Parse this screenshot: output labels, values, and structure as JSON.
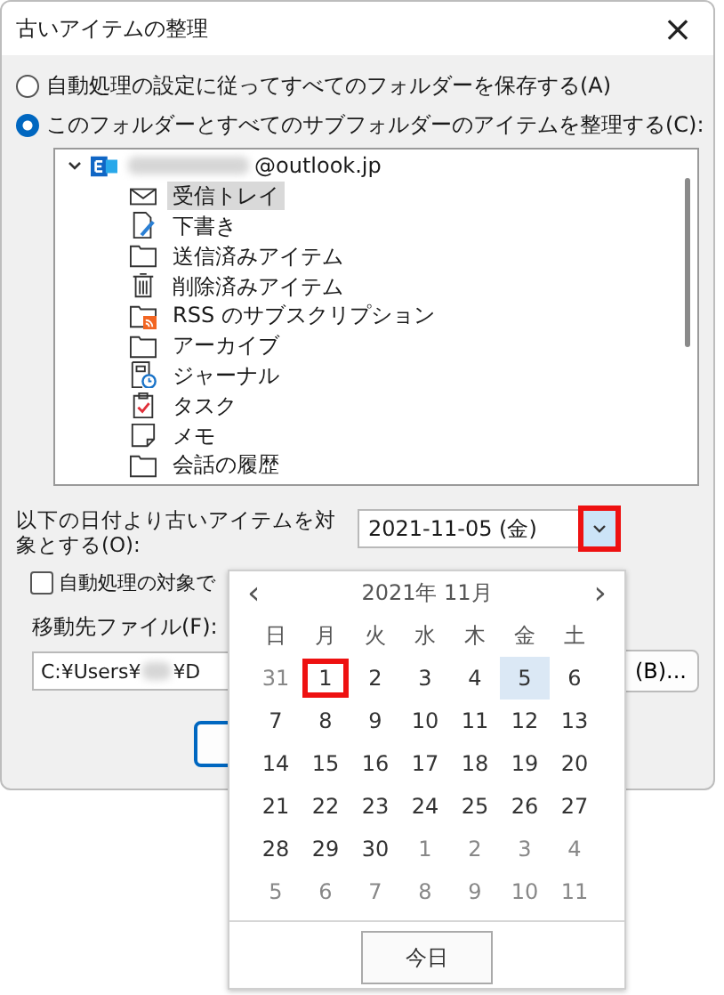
{
  "window": {
    "title": "古いアイテムの整理",
    "close": "×"
  },
  "options": [
    {
      "label": "自動処理の設定に従ってすべてのフォルダーを保存する(A)",
      "selected": false
    },
    {
      "label": "このフォルダーとすべてのサブフォルダーのアイテムを整理する(C):",
      "selected": true
    }
  ],
  "tree": {
    "account": {
      "label": "@outlook.jp",
      "expanded": true,
      "children": [
        {
          "kind": "inbox",
          "label": "受信トレイ",
          "selected": true
        },
        {
          "kind": "drafts",
          "label": "下書き",
          "selected": false
        },
        {
          "kind": "folder",
          "label": "送信済みアイテム",
          "selected": false
        },
        {
          "kind": "trash",
          "label": "削除済みアイテム",
          "selected": false
        },
        {
          "kind": "rss",
          "label": "RSS のサブスクリプション",
          "selected": false
        },
        {
          "kind": "folder",
          "label": "アーカイブ",
          "selected": false
        },
        {
          "kind": "journal",
          "label": "ジャーナル",
          "selected": false
        },
        {
          "kind": "tasks",
          "label": "タスク",
          "selected": false
        },
        {
          "kind": "notes",
          "label": "メモ",
          "selected": false
        },
        {
          "kind": "folder",
          "label": "会話の履歴",
          "selected": false
        }
      ]
    }
  },
  "date": {
    "label": "以下の日付より古いアイテムを対象とする(O):",
    "value": "2021-11-05 (金)",
    "dropdown_marked": true
  },
  "checkbox": {
    "label": "自動処理の対象で",
    "checked": false
  },
  "move_to": {
    "label": "移動先ファイル(F):",
    "path_start": "C:¥Users¥",
    "path_end": "¥D",
    "browse": "(B)..."
  },
  "calendar": {
    "prev": "‹",
    "title": "2021年 11月",
    "next": "›",
    "weekdays": [
      "日",
      "月",
      "火",
      "水",
      "木",
      "金",
      "土"
    ],
    "days": [
      {
        "d": "31",
        "other": true,
        "selected": false,
        "marked": false
      },
      {
        "d": "1",
        "other": false,
        "selected": false,
        "marked": true
      },
      {
        "d": "2",
        "other": false,
        "selected": false,
        "marked": false
      },
      {
        "d": "3",
        "other": false,
        "selected": false,
        "marked": false
      },
      {
        "d": "4",
        "other": false,
        "selected": false,
        "marked": false
      },
      {
        "d": "5",
        "other": false,
        "selected": true,
        "marked": false
      },
      {
        "d": "6",
        "other": false,
        "selected": false,
        "marked": false
      },
      {
        "d": "7",
        "other": false,
        "selected": false,
        "marked": false
      },
      {
        "d": "8",
        "other": false,
        "selected": false,
        "marked": false
      },
      {
        "d": "9",
        "other": false,
        "selected": false,
        "marked": false
      },
      {
        "d": "10",
        "other": false,
        "selected": false,
        "marked": false
      },
      {
        "d": "11",
        "other": false,
        "selected": false,
        "marked": false
      },
      {
        "d": "12",
        "other": false,
        "selected": false,
        "marked": false
      },
      {
        "d": "13",
        "other": false,
        "selected": false,
        "marked": false
      },
      {
        "d": "14",
        "other": false,
        "selected": false,
        "marked": false
      },
      {
        "d": "15",
        "other": false,
        "selected": false,
        "marked": false
      },
      {
        "d": "16",
        "other": false,
        "selected": false,
        "marked": false
      },
      {
        "d": "17",
        "other": false,
        "selected": false,
        "marked": false
      },
      {
        "d": "18",
        "other": false,
        "selected": false,
        "marked": false
      },
      {
        "d": "19",
        "other": false,
        "selected": false,
        "marked": false
      },
      {
        "d": "20",
        "other": false,
        "selected": false,
        "marked": false
      },
      {
        "d": "21",
        "other": false,
        "selected": false,
        "marked": false
      },
      {
        "d": "22",
        "other": false,
        "selected": false,
        "marked": false
      },
      {
        "d": "23",
        "other": false,
        "selected": false,
        "marked": false
      },
      {
        "d": "24",
        "other": false,
        "selected": false,
        "marked": false
      },
      {
        "d": "25",
        "other": false,
        "selected": false,
        "marked": false
      },
      {
        "d": "26",
        "other": false,
        "selected": false,
        "marked": false
      },
      {
        "d": "27",
        "other": false,
        "selected": false,
        "marked": false
      },
      {
        "d": "28",
        "other": false,
        "selected": false,
        "marked": false
      },
      {
        "d": "29",
        "other": false,
        "selected": false,
        "marked": false
      },
      {
        "d": "30",
        "other": false,
        "selected": false,
        "marked": false
      },
      {
        "d": "1",
        "other": true,
        "selected": false,
        "marked": false
      },
      {
        "d": "2",
        "other": true,
        "selected": false,
        "marked": false
      },
      {
        "d": "3",
        "other": true,
        "selected": false,
        "marked": false
      },
      {
        "d": "4",
        "other": true,
        "selected": false,
        "marked": false
      },
      {
        "d": "5",
        "other": true,
        "selected": false,
        "marked": false
      },
      {
        "d": "6",
        "other": true,
        "selected": false,
        "marked": false
      },
      {
        "d": "7",
        "other": true,
        "selected": false,
        "marked": false
      },
      {
        "d": "8",
        "other": true,
        "selected": false,
        "marked": false
      },
      {
        "d": "9",
        "other": true,
        "selected": false,
        "marked": false
      },
      {
        "d": "10",
        "other": true,
        "selected": false,
        "marked": false
      },
      {
        "d": "11",
        "other": true,
        "selected": false,
        "marked": false
      }
    ],
    "today": "今日"
  }
}
